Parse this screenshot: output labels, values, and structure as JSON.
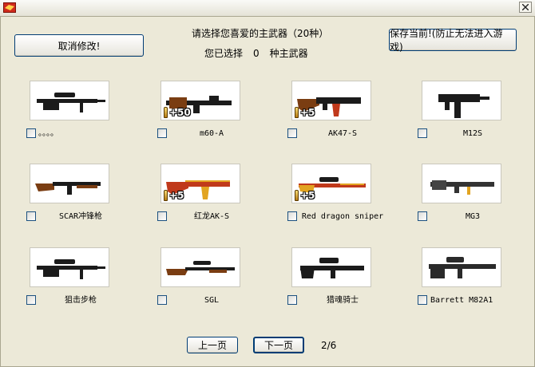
{
  "header": {
    "title_line": "请选择您喜爱的主武器（20种）",
    "selected_prefix": "您已选择",
    "selected_count": "0",
    "selected_suffix": "种主武器",
    "cancel_label": "取消修改!",
    "save_label": "保存当前!(防止无法进入游戏)"
  },
  "weapons": [
    {
      "label": "。。。。",
      "bonus": "",
      "icon": "sniper-rifle-icon"
    },
    {
      "label": "m60-A",
      "bonus": "+50",
      "icon": "machine-gun-icon"
    },
    {
      "label": "AK47-S",
      "bonus": "+5",
      "icon": "assault-rifle-icon"
    },
    {
      "label": "M12S",
      "bonus": "",
      "icon": "smg-icon"
    },
    {
      "label": "SCAR冲锋枪",
      "bonus": "",
      "icon": "rifle-icon"
    },
    {
      "label": "红龙AK-S",
      "bonus": "+5",
      "icon": "dragon-ak-icon"
    },
    {
      "label": "Red dragon sniper",
      "bonus": "+5",
      "icon": "dragon-sniper-icon"
    },
    {
      "label": "MG3",
      "bonus": "",
      "icon": "mg3-icon"
    },
    {
      "label": "狙击步枪",
      "bonus": "",
      "icon": "sniper-rifle-icon"
    },
    {
      "label": "SGL",
      "bonus": "",
      "icon": "scoped-rifle-icon"
    },
    {
      "label": "猎魂骑士",
      "bonus": "",
      "icon": "tactical-sniper-icon"
    },
    {
      "label": "Barrett M82A1",
      "bonus": "",
      "icon": "barrett-icon"
    }
  ],
  "pager": {
    "prev_label": "上一页",
    "next_label": "下一页",
    "page_info": "2/6"
  },
  "colors": {
    "window_bg": "#ece9d8",
    "button_border": "#003c74",
    "checkbox_border": "#1c5180"
  }
}
